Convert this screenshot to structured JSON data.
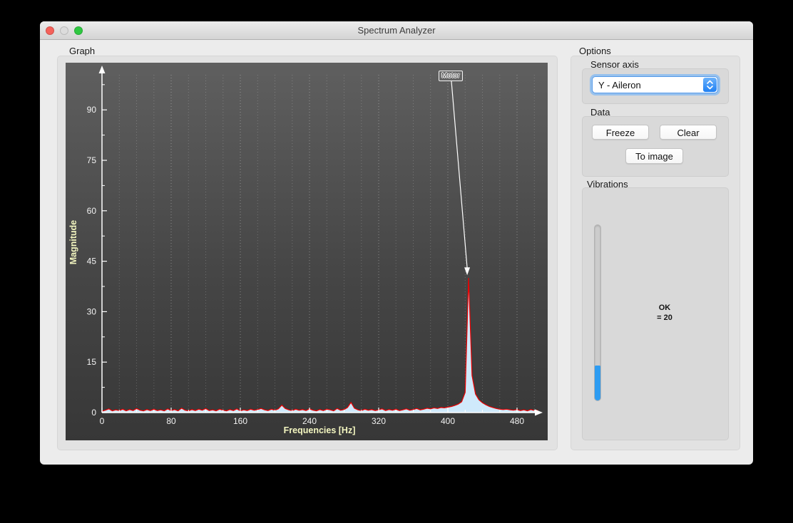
{
  "window": {
    "title": "Spectrum Analyzer"
  },
  "graph": {
    "group_label": "Graph"
  },
  "chart_data": {
    "type": "area",
    "title": "",
    "xlabel": "Frequencies [Hz]",
    "ylabel": "Magnitude",
    "xlim": [
      0,
      505
    ],
    "ylim": [
      0,
      104
    ],
    "x_major_ticks": [
      0,
      80,
      160,
      240,
      320,
      400,
      480
    ],
    "x_minor_step": 20,
    "y_major_ticks": [
      0,
      15,
      30,
      45,
      60,
      75,
      90
    ],
    "y_minor_step": 7.5,
    "grid": "vertical-dotted",
    "legend": "none",
    "axis_color": "#ffffff",
    "tick_label_color": "#f2f2f2",
    "axis_label_color": "#f3f6c0",
    "line_color": "#ee0000",
    "fill_color": "#cfe9fb",
    "annotation": {
      "text": "Motor",
      "points_to_hz": 424,
      "peak_magnitude": 40
    },
    "series": [
      {
        "name": "spectrum",
        "points": [
          [
            0,
            0.4
          ],
          [
            4,
            0.7
          ],
          [
            8,
            1.1
          ],
          [
            12,
            0.5
          ],
          [
            16,
            0.8
          ],
          [
            20,
            0.6
          ],
          [
            24,
            1.0
          ],
          [
            28,
            0.5
          ],
          [
            32,
            0.9
          ],
          [
            36,
            0.6
          ],
          [
            40,
            1.2
          ],
          [
            44,
            0.7
          ],
          [
            48,
            0.5
          ],
          [
            52,
            0.9
          ],
          [
            56,
            0.6
          ],
          [
            60,
            1.0
          ],
          [
            64,
            0.6
          ],
          [
            68,
            0.8
          ],
          [
            72,
            0.5
          ],
          [
            76,
            1.1
          ],
          [
            80,
            0.6
          ],
          [
            84,
            0.9
          ],
          [
            88,
            0.5
          ],
          [
            92,
            1.3
          ],
          [
            96,
            0.7
          ],
          [
            100,
            0.5
          ],
          [
            104,
            0.9
          ],
          [
            108,
            0.6
          ],
          [
            112,
            1.0
          ],
          [
            116,
            0.7
          ],
          [
            120,
            1.2
          ],
          [
            124,
            0.6
          ],
          [
            128,
            0.8
          ],
          [
            132,
            0.5
          ],
          [
            136,
            1.0
          ],
          [
            140,
            0.7
          ],
          [
            144,
            0.5
          ],
          [
            148,
            0.9
          ],
          [
            152,
            0.6
          ],
          [
            156,
            1.1
          ],
          [
            160,
            0.5
          ],
          [
            164,
            0.8
          ],
          [
            168,
            0.6
          ],
          [
            172,
            1.0
          ],
          [
            176,
            0.7
          ],
          [
            180,
            0.9
          ],
          [
            184,
            1.2
          ],
          [
            188,
            0.8
          ],
          [
            192,
            0.6
          ],
          [
            196,
            1.0
          ],
          [
            200,
            0.7
          ],
          [
            204,
            1.1
          ],
          [
            208,
            2.2
          ],
          [
            212,
            1.2
          ],
          [
            216,
            0.8
          ],
          [
            220,
            0.6
          ],
          [
            224,
            1.0
          ],
          [
            228,
            0.7
          ],
          [
            232,
            0.9
          ],
          [
            236,
            0.6
          ],
          [
            240,
            1.1
          ],
          [
            244,
            0.7
          ],
          [
            248,
            0.5
          ],
          [
            252,
            0.9
          ],
          [
            256,
            0.6
          ],
          [
            260,
            1.0
          ],
          [
            264,
            0.8
          ],
          [
            268,
            0.5
          ],
          [
            272,
            1.2
          ],
          [
            276,
            0.7
          ],
          [
            280,
            0.9
          ],
          [
            284,
            1.5
          ],
          [
            288,
            3.0
          ],
          [
            292,
            1.3
          ],
          [
            296,
            0.8
          ],
          [
            300,
            0.6
          ],
          [
            304,
            1.0
          ],
          [
            308,
            0.7
          ],
          [
            312,
            0.9
          ],
          [
            316,
            0.6
          ],
          [
            320,
            0.8
          ],
          [
            324,
            1.1
          ],
          [
            328,
            0.6
          ],
          [
            332,
            0.9
          ],
          [
            336,
            0.7
          ],
          [
            340,
            1.0
          ],
          [
            344,
            0.6
          ],
          [
            348,
            0.8
          ],
          [
            352,
            1.1
          ],
          [
            356,
            0.7
          ],
          [
            360,
            0.9
          ],
          [
            364,
            1.2
          ],
          [
            368,
            0.8
          ],
          [
            372,
            1.0
          ],
          [
            376,
            1.3
          ],
          [
            380,
            1.1
          ],
          [
            384,
            1.4
          ],
          [
            388,
            1.2
          ],
          [
            392,
            1.5
          ],
          [
            396,
            1.4
          ],
          [
            400,
            1.6
          ],
          [
            404,
            1.8
          ],
          [
            408,
            2.1
          ],
          [
            412,
            2.5
          ],
          [
            416,
            3.2
          ],
          [
            420,
            6.0
          ],
          [
            424,
            40
          ],
          [
            428,
            11
          ],
          [
            432,
            5.5
          ],
          [
            436,
            3.8
          ],
          [
            440,
            2.9
          ],
          [
            444,
            2.3
          ],
          [
            448,
            1.8
          ],
          [
            452,
            1.5
          ],
          [
            456,
            1.2
          ],
          [
            460,
            1.0
          ],
          [
            464,
            0.9
          ],
          [
            468,
            1.0
          ],
          [
            472,
            0.8
          ],
          [
            476,
            0.7
          ],
          [
            480,
            0.9
          ],
          [
            484,
            0.6
          ],
          [
            488,
            0.8
          ],
          [
            492,
            0.5
          ],
          [
            496,
            0.9
          ],
          [
            500,
            0.6
          ],
          [
            504,
            0.7
          ]
        ]
      }
    ]
  },
  "options": {
    "group_label": "Options",
    "sensor_axis": {
      "group_label": "Sensor axis",
      "selected": "Y - Aileron"
    },
    "data": {
      "group_label": "Data",
      "freeze_label": "Freeze",
      "clear_label": "Clear",
      "to_image_label": "To image"
    },
    "vibrations": {
      "group_label": "Vibrations",
      "status": "OK",
      "value_text": "= 20",
      "level_percent": 20
    }
  }
}
